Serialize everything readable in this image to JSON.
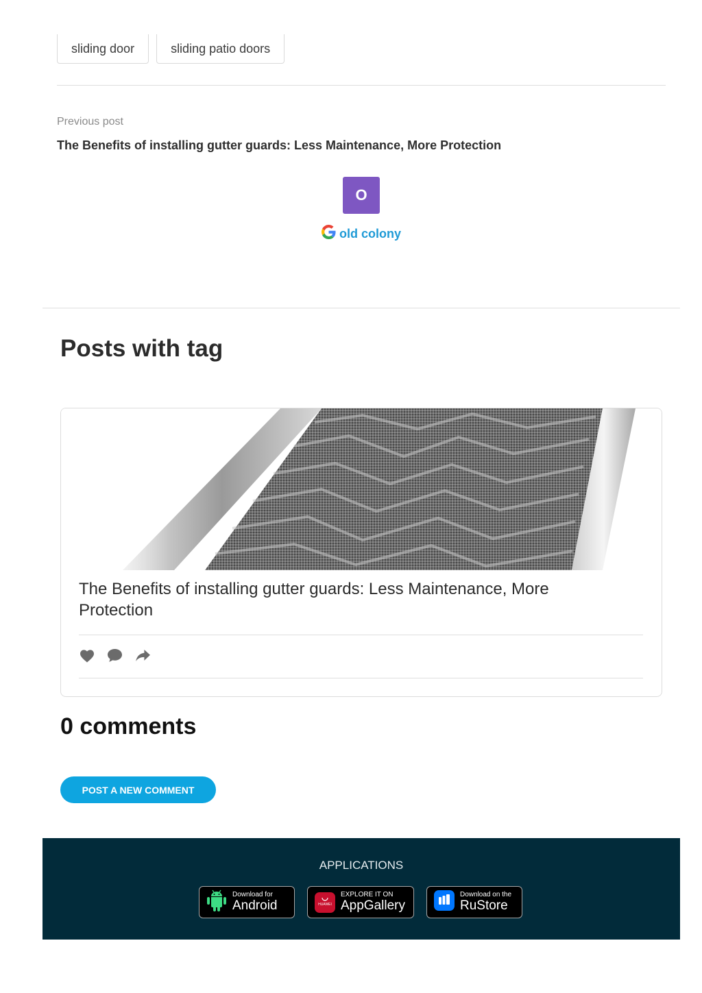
{
  "tags": [
    {
      "label": "sliding door"
    },
    {
      "label": "sliding patio doors"
    }
  ],
  "previous_post": {
    "label": "Previous post",
    "title": "The Benefits of installing gutter guards: Less Maintenance, More Protection"
  },
  "author": {
    "avatar_letter": "O",
    "avatar_color": "#7e57c2",
    "name": "old colony",
    "icon": "google-icon"
  },
  "posts_with_tag": {
    "heading": "Posts with tag",
    "card": {
      "title": "The Benefits of installing gutter guards: Less Maintenance, More Protection",
      "actions": [
        "heart-icon",
        "comment-icon",
        "share-icon"
      ]
    }
  },
  "comments": {
    "heading": "0 comments",
    "button_label": "POST A NEW COMMENT"
  },
  "footer": {
    "heading": "APPLICATIONS",
    "background": "#022b3a",
    "stores": [
      {
        "small": "Download for",
        "big": "Android",
        "icon": "android-icon"
      },
      {
        "small": "EXPLORE IT ON",
        "big": "AppGallery",
        "icon": "huawei-icon",
        "badge": "HUAWEI"
      },
      {
        "small": "Download on the",
        "big": "RuStore",
        "icon": "rustore-icon"
      }
    ]
  },
  "colors": {
    "accent": "#0ea5e0",
    "link": "#1e9ad6"
  }
}
